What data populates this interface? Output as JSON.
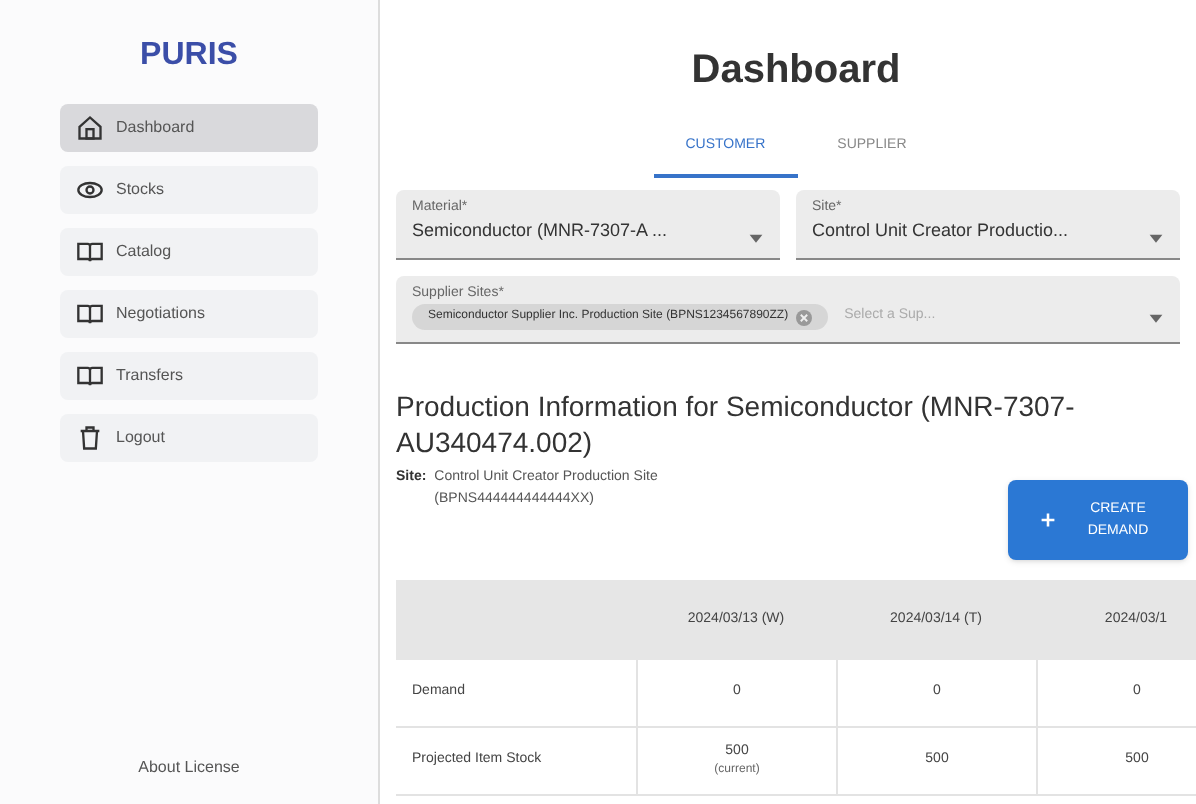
{
  "sidebar": {
    "logo": "PURIS",
    "items": [
      {
        "label": "Dashboard",
        "kind": "home",
        "selected": true
      },
      {
        "label": "Stocks",
        "kind": "eye",
        "selected": false
      },
      {
        "label": "Catalog",
        "kind": "book",
        "selected": false
      },
      {
        "label": "Negotiations",
        "kind": "book",
        "selected": false
      },
      {
        "label": "Transfers",
        "kind": "book",
        "selected": false
      },
      {
        "label": "Logout",
        "kind": "trash",
        "selected": false
      }
    ],
    "footer": "About License"
  },
  "title": "Dashboard",
  "tabs": [
    {
      "label": "CUSTOMER",
      "selected": true
    },
    {
      "label": "SUPPLIER",
      "selected": false
    }
  ],
  "fields": {
    "material": {
      "label": "Material*",
      "value": "Semiconductor (MNR-7307-A ..."
    },
    "site": {
      "label": "Site*",
      "value": "Control Unit Creator Productio..."
    },
    "supplier_sites": {
      "label": "Supplier Sites*",
      "chip": "Semiconductor Supplier Inc. Production Site (BPNS1234567890ZZ)",
      "placeholder": "Select a Sup..."
    }
  },
  "section": {
    "heading": "Production Information for Semiconductor (MNR-7307-AU340474.002)",
    "site_label": "Site:",
    "site_value": "Control Unit Creator Production Site (BPNS444444444444XX)",
    "button": "CREATE DEMAND"
  },
  "table": {
    "columns": [
      "2024/03/13 (W)",
      "2024/03/14 (T)",
      "2024/03/1"
    ],
    "rows": [
      {
        "label": "Demand",
        "cells": [
          {
            "value": "0"
          },
          {
            "value": "0"
          },
          {
            "value": "0"
          }
        ]
      },
      {
        "label": "Projected Item Stock",
        "cells": [
          {
            "value": "500",
            "note": "(current)"
          },
          {
            "value": "500"
          },
          {
            "value": "500"
          }
        ]
      }
    ]
  }
}
